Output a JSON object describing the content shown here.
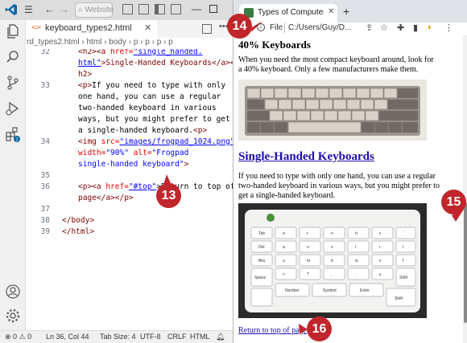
{
  "vscode": {
    "search_placeholder": "Website",
    "tab": {
      "filename": "keyboard_types2.html",
      "icon": "<>"
    },
    "breadcrumb": "rd_types2.html  ›  html  ›  body  ›  p  ›  p  ›  p  ›  p",
    "line_numbers": [
      "32",
      "",
      "33",
      "",
      "",
      "",
      "",
      "34",
      "",
      "",
      "35",
      "36",
      "",
      "37",
      "38",
      "39"
    ],
    "code": {
      "l32a_tag": "<h2><a ",
      "l32a_attr": "href=",
      "l32a_val": "\"single_handed.",
      "l32b_val": "html\"",
      "l32b_rest": ">Single-Handed Keyboards</a></",
      "l32c": "h2>",
      "l33a": "<p>",
      "l33a_text": "If you need to type with only",
      "l33b": "one hand, you can use a regular",
      "l33c": "two-handed keyboard in various",
      "l33d": "ways, but you might prefer to get",
      "l33e": "a single-handed keyboard.",
      "l33e_tag": "<p>",
      "l34a_tag": "<img ",
      "l34a_attr": "src=",
      "l34a_val": "\"images/frogpad_1024.png\"",
      "l34b_attr": "width=",
      "l34b_val": "\"90%\"",
      "l34b_attr2": " alt=",
      "l34b_val2": "\"Frogpad",
      "l34c_val": "single-handed keyboard\"",
      "l34c_tag": ">",
      "l36a_tag": "<p><a ",
      "l36a_attr": "href=",
      "l36a_val": "\"#top\"",
      "l36a_text": ">Return to top of",
      "l36b": "page</a></p>",
      "l38": "</body>",
      "l39": "</html>"
    },
    "status": {
      "problems": "⊗ 0 ⚠ 0",
      "position": "Ln 36, Col 44",
      "tab_size": "Tab Size: 4",
      "encoding": "UTF-8",
      "eol": "CRLF",
      "language": "HTML"
    },
    "badge_count": "2"
  },
  "browser": {
    "tab_title": "Types of Computer Keyboards",
    "file_label": "File",
    "url": "C:/Users/Guy/D...",
    "page": {
      "heading_40": "40% Keyboards",
      "para_40": "When you need the most compact keyboard around, look for a 40% keyboard. Only a few manufacturers make them.",
      "heading_single": "Single-Handed Keyboards",
      "para_single": "If you need to type with only one hand, you can use a regular two-handed keyboard in various ways, but you might prefer to get a single-handed keyboard.",
      "back_to_top": "Return to top of page"
    }
  },
  "callouts": [
    "13",
    "14",
    "15",
    "16"
  ],
  "colors": {
    "callout": "#c0262c",
    "link": "#1a0dab",
    "vscode_blue": "#0065a9"
  }
}
